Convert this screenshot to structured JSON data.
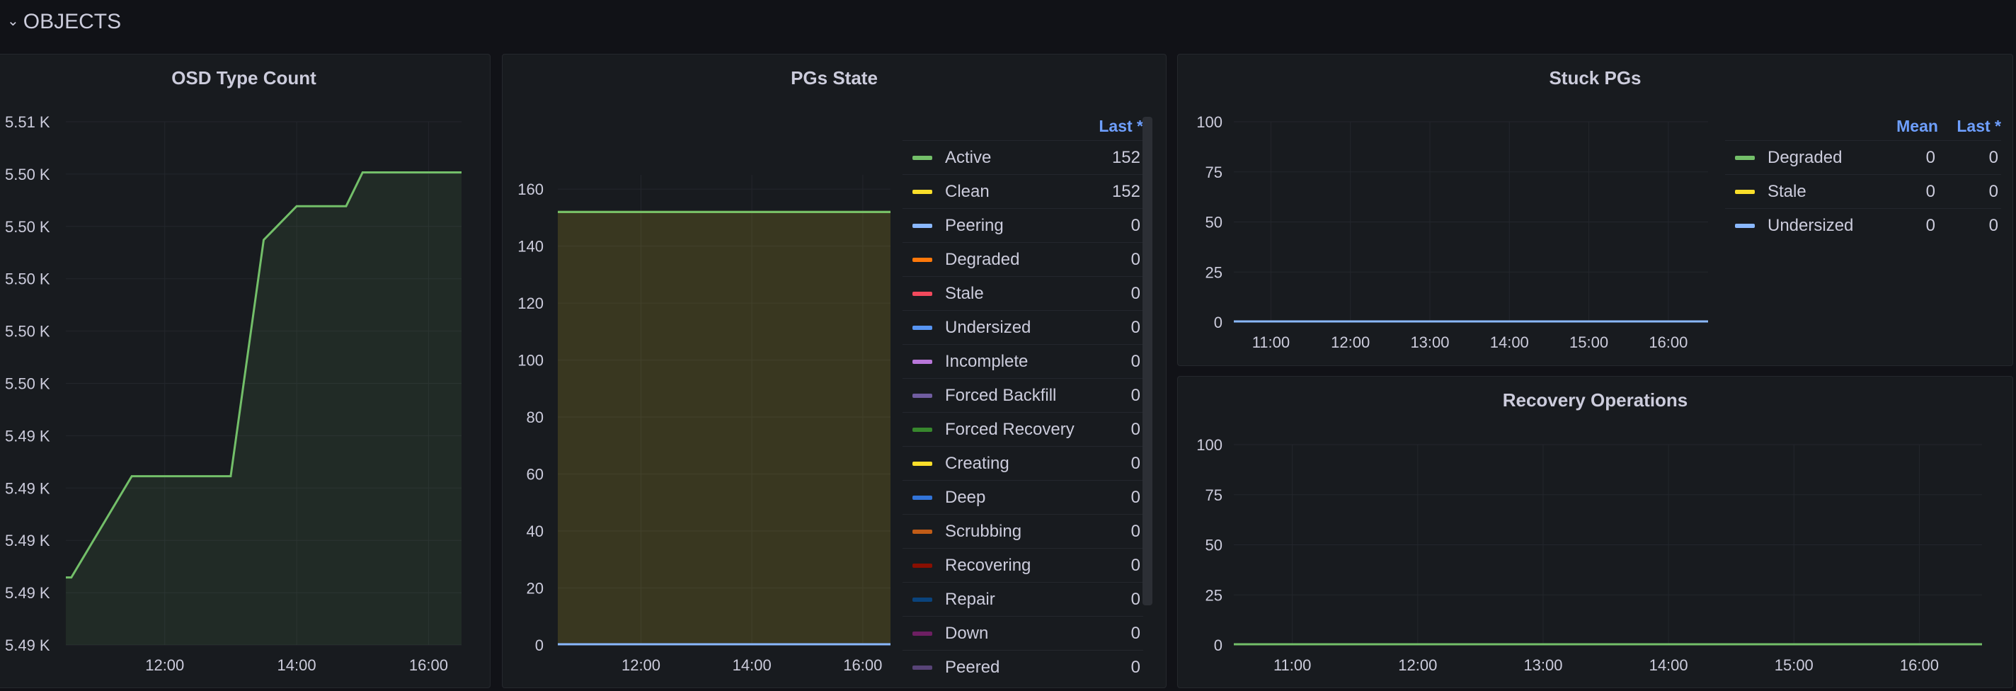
{
  "row": {
    "title": "OBJECTS",
    "chevron": "chevron-down-icon",
    "chevron_glyph": "⌄"
  },
  "colors": {
    "green": "#73bf69",
    "yellow": "#fade2a",
    "blue": "#8ab8ff",
    "orange": "#ff780a",
    "red": "#f2495c",
    "lightblue": "#5794f2",
    "purple": "#b877d9",
    "darkpurple": "#705da0",
    "darkgreen": "#37872d",
    "brightyellow": "#fade2a",
    "deepblue": "#3274d9",
    "scrub": "#c15c17",
    "darkred": "#890f02",
    "navy": "#0a437c",
    "darkviolet": "#6d1f62",
    "violet": "#584477",
    "accent": "#6e9fff"
  },
  "osd": {
    "title": "OSD Type Count",
    "chart_data": {
      "type": "area",
      "x_tick_labels": [
        "12:00",
        "14:00",
        "16:00"
      ],
      "y_tick_labels": [
        "5.51 K",
        "5.50 K",
        "5.50 K",
        "5.50 K",
        "5.50 K",
        "5.50 K",
        "5.49 K",
        "5.49 K",
        "5.49 K",
        "5.49 K",
        "5.49 K"
      ],
      "x": [
        "10:30",
        "10:35",
        "11:30",
        "12:00",
        "12:30",
        "13:00",
        "13:30",
        "14:00",
        "14:30",
        "14:45",
        "15:00",
        "15:30",
        "16:00",
        "16:30"
      ],
      "series": [
        {
          "values": [
            5490,
            5490,
            5493,
            5493,
            5493,
            5493,
            5500,
            5501,
            5501,
            5501,
            5502,
            5502,
            5502,
            5502
          ],
          "color": "#73bf69"
        }
      ]
    }
  },
  "pgs": {
    "title": "PGs State",
    "legend_header": "Last *",
    "chart_data": {
      "type": "area",
      "x_tick_labels": [
        "12:00",
        "14:00",
        "16:00"
      ],
      "y_tick_labels": [
        "0",
        "20",
        "40",
        "60",
        "80",
        "100",
        "120",
        "140",
        "160"
      ],
      "ylim": [
        0,
        165
      ],
      "series": [
        {
          "name": "Active",
          "last": "152",
          "value": 152,
          "color": "#73bf69"
        },
        {
          "name": "Clean",
          "last": "152",
          "value": 152,
          "color": "#fade2a"
        },
        {
          "name": "Peering",
          "last": "0",
          "value": 0,
          "color": "#8ab8ff"
        },
        {
          "name": "Degraded",
          "last": "0",
          "value": 0,
          "color": "#ff780a"
        },
        {
          "name": "Stale",
          "last": "0",
          "value": 0,
          "color": "#f2495c"
        },
        {
          "name": "Undersized",
          "last": "0",
          "value": 0,
          "color": "#5794f2"
        },
        {
          "name": "Incomplete",
          "last": "0",
          "value": 0,
          "color": "#b877d9"
        },
        {
          "name": "Forced Backfill",
          "last": "0",
          "value": 0,
          "color": "#705da0"
        },
        {
          "name": "Forced Recovery",
          "last": "0",
          "value": 0,
          "color": "#37872d"
        },
        {
          "name": "Creating",
          "last": "0",
          "value": 0,
          "color": "#fade2a"
        },
        {
          "name": "Deep",
          "last": "0",
          "value": 0,
          "color": "#3274d9"
        },
        {
          "name": "Scrubbing",
          "last": "0",
          "value": 0,
          "color": "#c15c17"
        },
        {
          "name": "Recovering",
          "last": "0",
          "value": 0,
          "color": "#890f02"
        },
        {
          "name": "Repair",
          "last": "0",
          "value": 0,
          "color": "#0a437c"
        },
        {
          "name": "Down",
          "last": "0",
          "value": 0,
          "color": "#6d1f62"
        },
        {
          "name": "Peered",
          "last": "0",
          "value": 0,
          "color": "#584477"
        }
      ]
    }
  },
  "stuck": {
    "title": "Stuck PGs",
    "legend_headers": [
      "Mean",
      "Last *"
    ],
    "chart_data": {
      "type": "line",
      "x_tick_labels": [
        "11:00",
        "12:00",
        "13:00",
        "14:00",
        "15:00",
        "16:00"
      ],
      "y_tick_labels": [
        "0",
        "25",
        "50",
        "75",
        "100"
      ],
      "ylim": [
        0,
        100
      ],
      "series": [
        {
          "name": "Degraded",
          "mean": "0",
          "last": "0",
          "value": 0,
          "color": "#73bf69"
        },
        {
          "name": "Stale",
          "mean": "0",
          "last": "0",
          "value": 0,
          "color": "#fade2a"
        },
        {
          "name": "Undersized",
          "mean": "0",
          "last": "0",
          "value": 0,
          "color": "#8ab8ff"
        }
      ]
    }
  },
  "recovery": {
    "title": "Recovery Operations",
    "chart_data": {
      "type": "line",
      "x_tick_labels": [
        "11:00",
        "12:00",
        "13:00",
        "14:00",
        "15:00",
        "16:00"
      ],
      "y_tick_labels": [
        "0",
        "25",
        "50",
        "75",
        "100"
      ],
      "ylim": [
        0,
        100
      ],
      "series": [
        {
          "value": 0,
          "color": "#73bf69"
        }
      ]
    }
  }
}
